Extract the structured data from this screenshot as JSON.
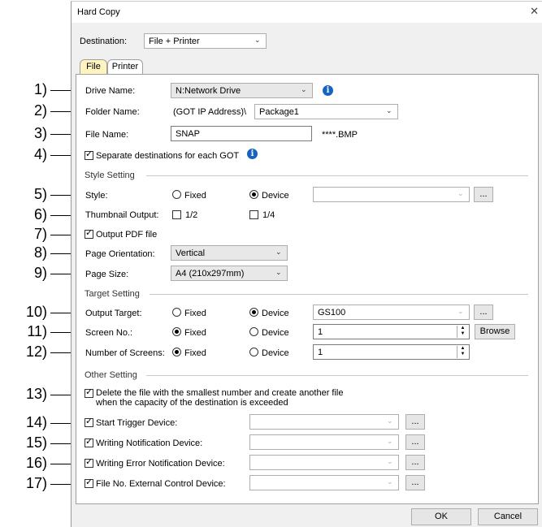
{
  "window": {
    "title": "Hard Copy",
    "close_glyph": "✕"
  },
  "destination": {
    "label": "Destination:",
    "value": "File + Printer"
  },
  "tabs": [
    {
      "label": "File"
    },
    {
      "label": "Printer"
    }
  ],
  "callouts": [
    "1)",
    "2)",
    "3)",
    "4)",
    "5)",
    "6)",
    "7)",
    "8)",
    "9)",
    "10)",
    "11)",
    "12)",
    "13)",
    "14)",
    "15)",
    "16)",
    "17)"
  ],
  "drive": {
    "label": "Drive Name:",
    "value": "N:Network Drive",
    "info_icon": "info-icon"
  },
  "folder": {
    "label": "Folder Name:",
    "prefix": "(GOT IP Address)\\",
    "value": "Package1"
  },
  "file_name": {
    "label": "File Name:",
    "value": "SNAP",
    "suffix": "****.BMP"
  },
  "separate_dest": {
    "label": "Separate destinations for each GOT",
    "checked": true
  },
  "style_section": {
    "title": "Style Setting"
  },
  "style": {
    "label": "Style:",
    "fixed": "Fixed",
    "device": "Device",
    "selected": "device",
    "value": "",
    "browse_dots": "..."
  },
  "thumbnail": {
    "label": "Thumbnail Output:",
    "opt1": "1/2",
    "opt2": "1/4"
  },
  "pdf": {
    "label": "Output PDF file",
    "checked": true
  },
  "orientation": {
    "label": "Page Orientation:",
    "value": "Vertical"
  },
  "page_size": {
    "label": "Page Size:",
    "value": "A4 (210x297mm)"
  },
  "target_section": {
    "title": "Target Setting"
  },
  "output_target": {
    "label": "Output Target:",
    "fixed": "Fixed",
    "device": "Device",
    "selected": "device",
    "value": "GS100",
    "browse_dots": "..."
  },
  "screen_no": {
    "label": "Screen No.:",
    "fixed": "Fixed",
    "device": "Device",
    "selected": "fixed",
    "value": "1",
    "browse": "Browse"
  },
  "num_screens": {
    "label": "Number of Screens:",
    "fixed": "Fixed",
    "device": "Device",
    "selected": "fixed",
    "value": "1"
  },
  "other_section": {
    "title": "Other Setting"
  },
  "delete_oldest": {
    "line1": "Delete the file with the smallest number and create another file",
    "line2": "when the capacity of the destination is exceeded",
    "checked": true
  },
  "devices": [
    {
      "label": "Start Trigger Device:",
      "checked": true,
      "dots": "..."
    },
    {
      "label": "Writing Notification Device:",
      "checked": true,
      "dots": "..."
    },
    {
      "label": "Writing Error Notification Device:",
      "checked": true,
      "dots": "..."
    },
    {
      "label": "File No. External Control Device:",
      "checked": true,
      "dots": "..."
    }
  ],
  "buttons": {
    "ok": "OK",
    "cancel": "Cancel"
  },
  "glyphs": {
    "check": "✓",
    "arrow": "⌄",
    "up": "▲",
    "down": "▼"
  }
}
